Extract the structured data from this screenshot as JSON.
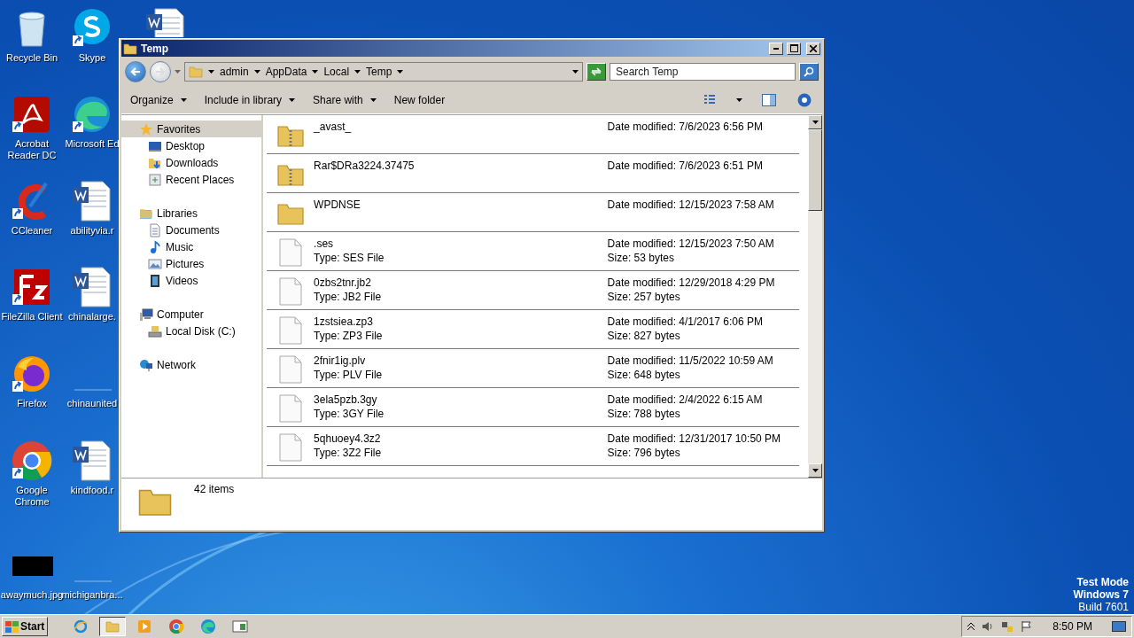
{
  "desktop_icons": [
    {
      "label": "Recycle Bin",
      "kind": "recycle",
      "shortcut": false
    },
    {
      "label": "Acrobat Reader DC",
      "kind": "acrobat",
      "shortcut": true
    },
    {
      "label": "CCleaner",
      "kind": "ccleaner",
      "shortcut": true
    },
    {
      "label": "FileZilla Client",
      "kind": "filezilla",
      "shortcut": true
    },
    {
      "label": "Firefox",
      "kind": "firefox",
      "shortcut": true
    },
    {
      "label": "Google Chrome",
      "kind": "chrome",
      "shortcut": true
    },
    {
      "label": "awaymuch.jpg",
      "shortcut": false
    },
    {
      "label": "Skype",
      "kind": "skype",
      "shortcut": true
    },
    {
      "label": "Microsoft Ed",
      "kind": "edge",
      "shortcut": true
    },
    {
      "label": "abilityvia.r",
      "kind": "word",
      "shortcut": false
    },
    {
      "label": "chinalarge.",
      "kind": "word",
      "shortcut": false
    },
    {
      "label": "chinaunited",
      "kind": "blank",
      "shortcut": false
    },
    {
      "label": "kindfood.r",
      "kind": "word",
      "shortcut": false
    },
    {
      "label": "michiganbra...",
      "kind": "blank",
      "shortcut": false
    }
  ],
  "window": {
    "title": "Temp",
    "breadcrumb": [
      "admin",
      "AppData",
      "Local",
      "Temp"
    ],
    "search": {
      "placeholder": "Search Temp"
    },
    "commands": [
      {
        "label": "Organize",
        "dropdown": true
      },
      {
        "label": "Include in library",
        "dropdown": true
      },
      {
        "label": "Share with",
        "dropdown": true
      },
      {
        "label": "New folder",
        "dropdown": false
      }
    ],
    "nav": [
      {
        "label": "Favorites",
        "kind": "favorites",
        "selected": true,
        "children": [
          {
            "label": "Desktop",
            "kind": "desktop",
            "selected": false
          },
          {
            "label": "Downloads",
            "kind": "downloads",
            "selected": false
          },
          {
            "label": "Recent Places",
            "kind": "recent",
            "selected": false
          }
        ]
      },
      {
        "label": "Libraries",
        "kind": "libraries",
        "selected": false,
        "children": [
          {
            "label": "Documents",
            "kind": "documents",
            "selected": false
          },
          {
            "label": "Music",
            "kind": "music",
            "selected": false
          },
          {
            "label": "Pictures",
            "kind": "pictures",
            "selected": false
          },
          {
            "label": "Videos",
            "kind": "videos",
            "selected": false
          }
        ]
      },
      {
        "label": "Computer",
        "kind": "computer",
        "selected": false,
        "children": [
          {
            "label": "Local Disk (C:)",
            "kind": "disk",
            "selected": false
          }
        ]
      },
      {
        "label": "Network",
        "kind": "network",
        "selected": false
      }
    ],
    "files": [
      {
        "name": "_avast_",
        "kind": "zipfolder",
        "modified": "Date modified: 7/6/2023 6:56 PM"
      },
      {
        "name": "Rar$DRa3224.37475",
        "kind": "zipfolder",
        "modified": "Date modified: 7/6/2023 6:51 PM"
      },
      {
        "name": "WPDNSE",
        "kind": "folder",
        "modified": "Date modified: 12/15/2023 7:58 AM"
      },
      {
        "name": ".ses",
        "kind": "file",
        "type": "Type: SES File",
        "modified": "Date modified: 12/15/2023 7:50 AM",
        "size": "Size: 53 bytes"
      },
      {
        "name": "0zbs2tnr.jb2",
        "kind": "file",
        "type": "Type: JB2 File",
        "modified": "Date modified: 12/29/2018 4:29 PM",
        "size": "Size: 257 bytes"
      },
      {
        "name": "1zstsiea.zp3",
        "kind": "file",
        "type": "Type: ZP3 File",
        "modified": "Date modified: 4/1/2017 6:06 PM",
        "size": "Size: 827 bytes"
      },
      {
        "name": "2fnir1ig.plv",
        "kind": "file",
        "type": "Type: PLV File",
        "modified": "Date modified: 11/5/2022 10:59 AM",
        "size": "Size: 648 bytes"
      },
      {
        "name": "3ela5pzb.3gy",
        "kind": "file",
        "type": "Type: 3GY File",
        "modified": "Date modified: 2/4/2022 6:15 AM",
        "size": "Size: 788 bytes"
      },
      {
        "name": "5qhuoey4.3z2",
        "kind": "file",
        "type": "Type: 3Z2 File",
        "modified": "Date modified: 12/31/2017 10:50 PM",
        "size": "Size: 796 bytes"
      }
    ],
    "status": "42 items"
  },
  "taskbar": {
    "start": "Start",
    "apps": [
      {
        "kind": "ie",
        "selected": false
      },
      {
        "kind": "explorer",
        "selected": true
      },
      {
        "kind": "media",
        "selected": false
      },
      {
        "kind": "chrome",
        "selected": false
      },
      {
        "kind": "edge",
        "selected": false
      },
      {
        "kind": "app",
        "selected": false
      }
    ],
    "clock": "8:50 PM"
  },
  "os_notice": [
    "Test Mode",
    "Windows 7",
    "Build 7601"
  ]
}
